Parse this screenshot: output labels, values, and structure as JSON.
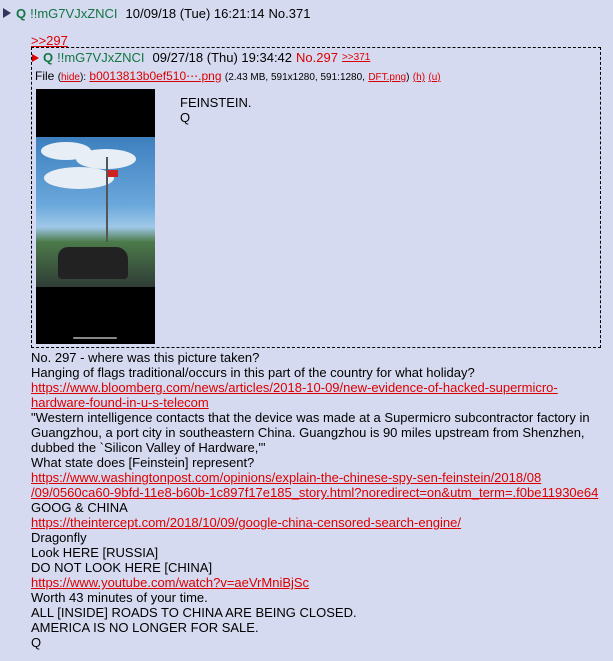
{
  "post": {
    "name": "Q",
    "tripcode": "!!mG7VJxZNCI",
    "date": "10/09/18 (Tue) 16:21:14",
    "number": "No.371"
  },
  "backlink": ">>297",
  "quoted_post": {
    "name": "Q",
    "tripcode": "!!mG7VJxZNCI",
    "date": "09/27/18 (Thu) 19:34:42",
    "number": "No.297",
    "backref": ">>371",
    "file_label": "File",
    "hide": "hide",
    "filename": "b0013813b0ef510⋯.png",
    "file_meta": "(2.43 MB, 591x1280, 591:1280,",
    "dft": "DFT.png",
    "h": "(h)",
    "u": "(u)",
    "lines": [
      "FEINSTEIN.",
      "Q"
    ]
  },
  "body": {
    "l1": "No. 297 - where was this picture taken?",
    "l2": "Hanging of flags traditional/occurs in this part of the country for what holiday?",
    "url1a": "https://www.bloomberg.com/news/articles/2018-10-09/new-evidence-of-hacked-supermicro-",
    "url1b": "hardware-found-in-u-s-telecom",
    "quote": "\"Western intelligence contacts that the device was made at a Supermicro subcontractor factory in Guangzhou, a port city in southeastern China. Guangzhou is 90 miles upstream from Shenzhen, dubbed the `Silicon Valley of Hardware,'\"",
    "l3": "What state does [Feinstein] represent?",
    "url2a": "https://www.washingtonpost.com/opinions/explain-the-chinese-spy-sen-feinstein/2018/08",
    "url2b": "/09/0560ca60-9bfd-11e8-b60b-1c897f17e185_story.html?noredirect=on&utm_term=.f0be11930e64",
    "l4": "GOOG & CHINA",
    "url3": "https://theintercept.com/2018/10/09/google-china-censored-search-engine/",
    "l5": "Dragonfly",
    "l6": "Look HERE [RUSSIA]",
    "l7": "DO NOT LOOK HERE [CHINA]",
    "url4": "https://www.youtube.com/watch?v=aeVrMniBjSc",
    "l8": "Worth 43 minutes of your time.",
    "l9": "ALL [INSIDE] ROADS TO CHINA ARE BEING CLOSED.",
    "l10": "AMERICA IS NO LONGER FOR SALE.",
    "l11": "Q"
  }
}
